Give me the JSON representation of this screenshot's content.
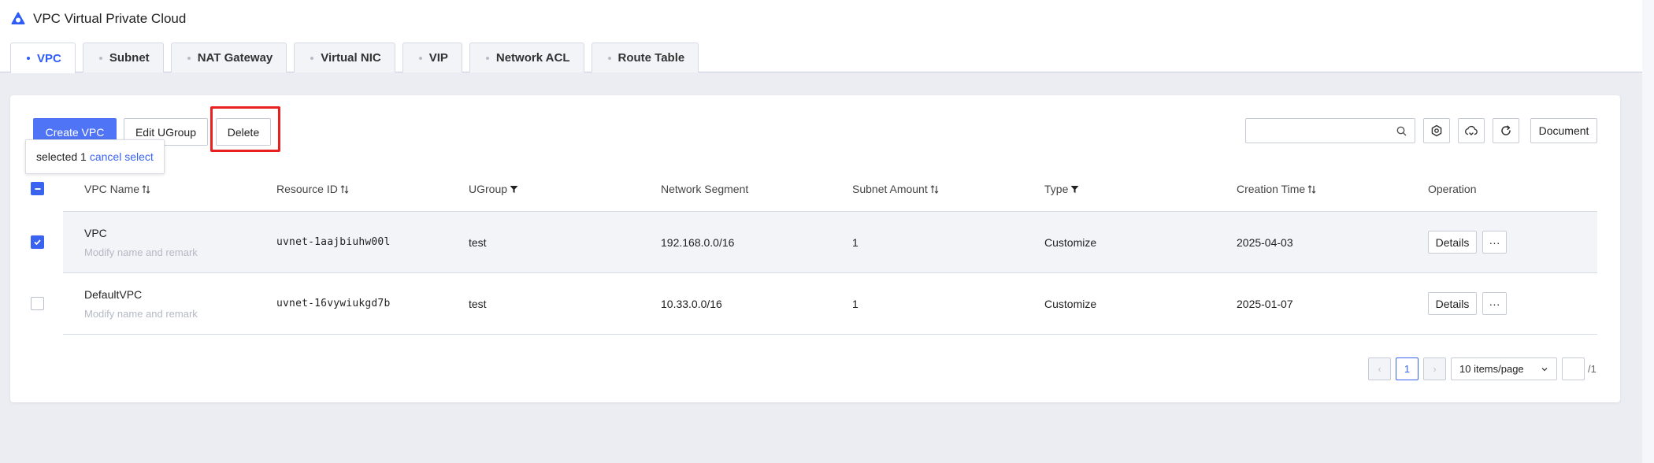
{
  "app": {
    "title": "VPC Virtual Private Cloud",
    "logo_icon": "cloud-triangle-logo-icon",
    "accent": "#2d5cf6"
  },
  "tabs": [
    {
      "label": "VPC",
      "active": true
    },
    {
      "label": "Subnet",
      "active": false
    },
    {
      "label": "NAT Gateway",
      "active": false
    },
    {
      "label": "Virtual NIC",
      "active": false
    },
    {
      "label": "VIP",
      "active": false
    },
    {
      "label": "Network ACL",
      "active": false
    },
    {
      "label": "Route Table",
      "active": false
    }
  ],
  "toolbar": {
    "create_label": "Create VPC",
    "edit_ugroup_label": "Edit UGroup",
    "delete_label": "Delete",
    "search_placeholder": "",
    "search_icon": "search-icon",
    "settings_icon": "gear-icon",
    "cloud_icon": "cloud-refresh-icon",
    "refresh_icon": "refresh-icon",
    "document_label": "Document",
    "highlight_color": "#e8201f"
  },
  "selection": {
    "prefix": "selected",
    "count": "1",
    "cancel_label": "cancel select"
  },
  "table": {
    "columns": {
      "name": "VPC Name",
      "resource_id": "Resource ID",
      "ugroup": "UGroup",
      "segment": "Network Segment",
      "subnet_amount": "Subnet Amount",
      "type": "Type",
      "creation_time": "Creation Time",
      "operation": "Operation"
    },
    "rows": [
      {
        "name": "VPC",
        "remark": "Modify name and remark",
        "resource_id": "uvnet-1aajbiuhw00l",
        "ugroup": "test",
        "segment": "192.168.0.0/16",
        "subnet_amount": "1",
        "type": "Customize",
        "creation_time": "2025-04-03",
        "details": "Details",
        "more": "···",
        "selected": true
      },
      {
        "name": "DefaultVPC",
        "remark": "Modify name and remark",
        "resource_id": "uvnet-16vywiukgd7b",
        "ugroup": "test",
        "segment": "10.33.0.0/16",
        "subnet_amount": "1",
        "type": "Customize",
        "creation_time": "2025-01-07",
        "details": "Details",
        "more": "···",
        "selected": false
      }
    ]
  },
  "pagination": {
    "prev": "‹",
    "current": "1",
    "next": "›",
    "page_size": "10 items/page",
    "jump_value": "",
    "total": "/1"
  }
}
